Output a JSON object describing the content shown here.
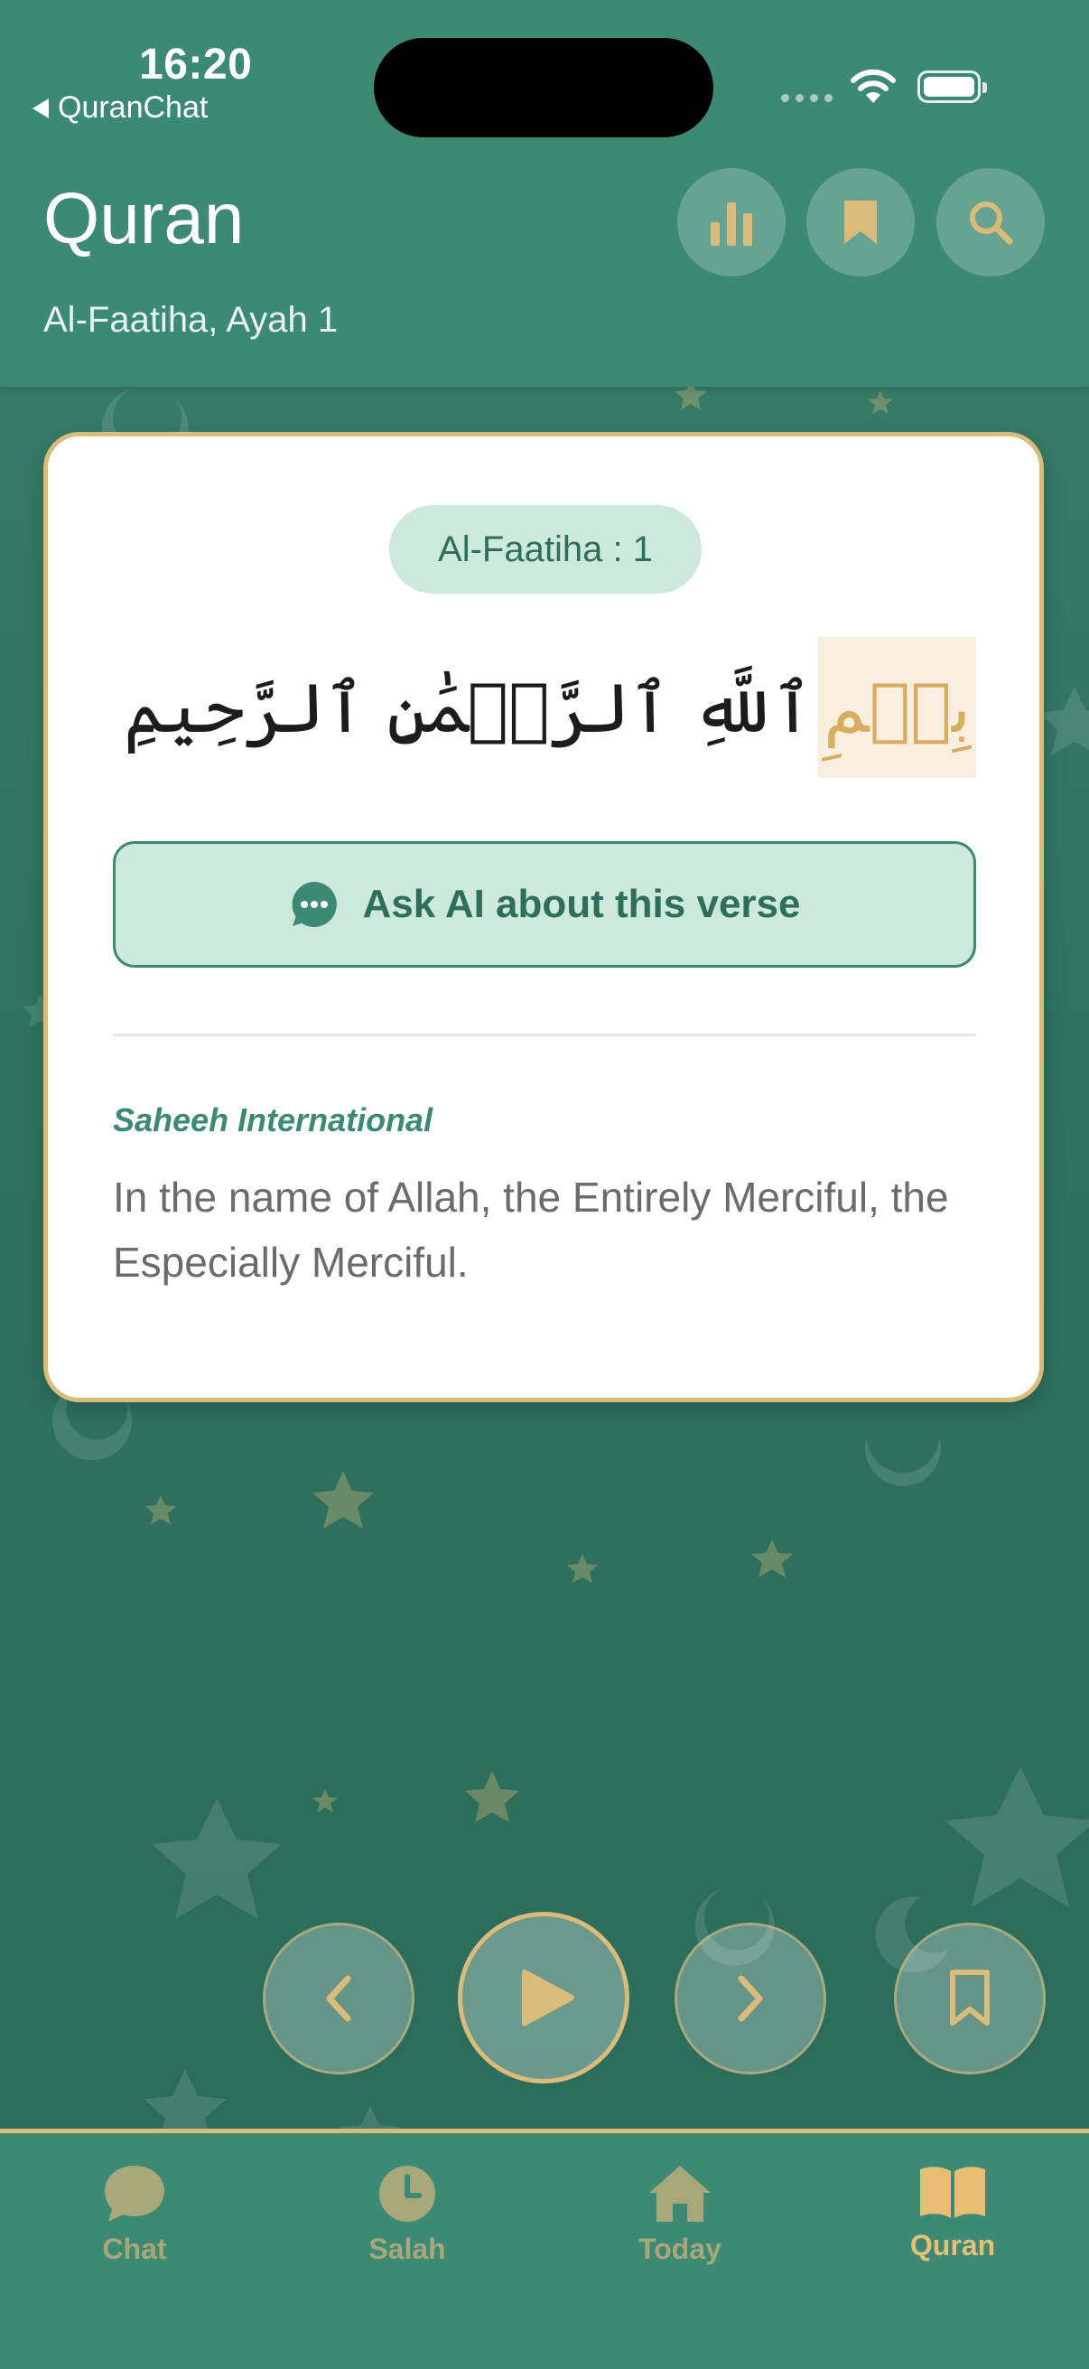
{
  "status_bar": {
    "time": "16:20",
    "back_app": "QuranChat"
  },
  "header": {
    "title": "Quran",
    "subtitle": "Al-Faatiha, Ayah 1",
    "buttons": [
      {
        "name": "stats",
        "icon": "bar-chart-icon"
      },
      {
        "name": "bookmarks",
        "icon": "bookmark-icon"
      },
      {
        "name": "search",
        "icon": "search-icon"
      }
    ]
  },
  "verse": {
    "reference": "Al-Faatiha : 1",
    "arabic_highlighted": "بِسۡمِ",
    "arabic_rest": "ٱللَّهِ ٱلرَّحۡمَٰنِ ٱلرَّحِيمِ",
    "ask_ai_label": "Ask AI about this verse",
    "translator": "Saheeh International",
    "translation": "In the name of Allah, the Entirely Merciful, the Especially Merciful."
  },
  "player": {
    "controls": [
      "previous",
      "play",
      "next",
      "bookmark"
    ]
  },
  "tabs": [
    {
      "label": "Chat",
      "icon": "chat-bubble-icon",
      "active": false
    },
    {
      "label": "Salah",
      "icon": "clock-icon",
      "active": false
    },
    {
      "label": "Today",
      "icon": "home-icon",
      "active": false
    },
    {
      "label": "Quran",
      "icon": "open-book-icon",
      "active": true
    }
  ],
  "colors": {
    "primary_green": "#3d8a74",
    "dark_green": "#2f725f",
    "gold": "#d9bb7a",
    "pill_bg": "#cde8dd",
    "inactive_tab": "#a7a77a"
  }
}
